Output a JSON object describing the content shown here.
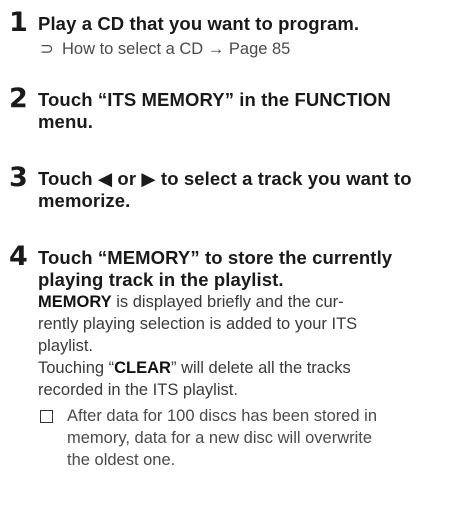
{
  "steps": [
    {
      "number": "1",
      "heading": "Play a CD that you want to program.",
      "xref": {
        "arrow_glyph": "⊃",
        "text": "How to select a CD → Page 85"
      }
    },
    {
      "number": "2",
      "heading_line1": "Touch “ITS MEMORY” in the FUNCTION",
      "heading_line2": "menu."
    },
    {
      "number": "3",
      "heading_line1": "Touch ◀ or ▶ to select a track you want to",
      "heading_line2": "memorize."
    },
    {
      "number": "4",
      "heading_line1": "Touch “MEMORY” to store the currently",
      "heading_line2": "playing track in the playlist.",
      "para1_bold": "MEMORY",
      "para1_line1_rest": " is displayed briefly and the cur-",
      "para1_line2": "rently playing selection is added to your ITS",
      "para1_line3": "playlist.",
      "para2_pre": "Touching “",
      "para2_bold": "CLEAR",
      "para2_post": "” will delete all the tracks",
      "para2_line2": "recorded in the ITS playlist.",
      "note_line1": "After data for 100 discs has been stored in",
      "note_line2": "memory, data for a new disc will overwrite",
      "note_line3": "the oldest one."
    }
  ]
}
